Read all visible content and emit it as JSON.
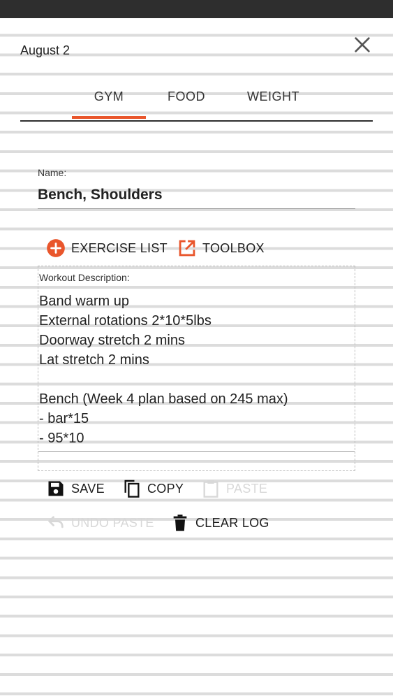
{
  "header": {
    "date": "August 2"
  },
  "tabs": [
    {
      "label": "GYM",
      "active": true
    },
    {
      "label": "FOOD",
      "active": false
    },
    {
      "label": "WEIGHT",
      "active": false
    }
  ],
  "form": {
    "name_label": "Name:",
    "name_value": "Bench, Shoulders",
    "description_label": "Workout Description:",
    "description_lines": [
      "Band warm up",
      "External rotations 2*10*5lbs",
      "Doorway stretch 2 mins",
      "Lat stretch 2 mins",
      "",
      "Bench (Week 4 plan based on 245 max)",
      "- bar*15",
      "- 95*10"
    ]
  },
  "actions": {
    "exercise_list": "EXERCISE LIST",
    "toolbox": "TOOLBOX",
    "save": "SAVE",
    "copy": "COPY",
    "paste": "PASTE",
    "undo_paste": "UNDO PASTE",
    "clear_log": "CLEAR LOG"
  },
  "colors": {
    "accent": "#e9562c",
    "status_bar": "#2e2e2e",
    "disabled_text": "#d8d8d8"
  },
  "icons": {
    "close": "close-icon",
    "exercise_list": "add-circle-icon",
    "toolbox": "open-in-new-icon",
    "save": "floppy-disk-icon",
    "copy": "copy-icon",
    "paste": "clipboard-icon",
    "undo": "undo-icon",
    "clear": "trash-icon"
  }
}
